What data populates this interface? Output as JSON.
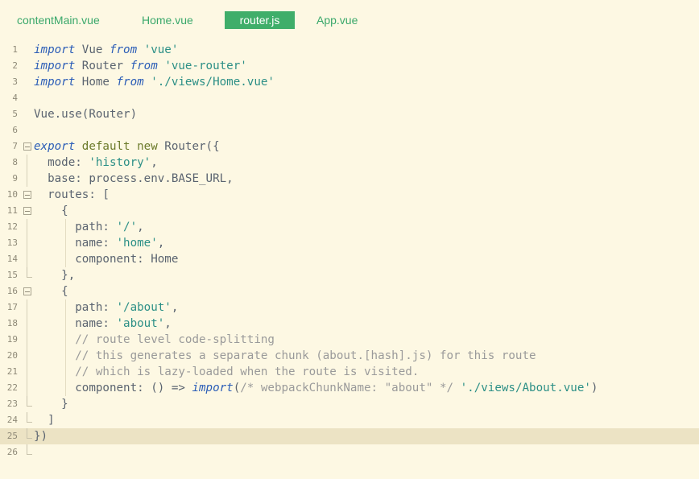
{
  "tabs": [
    {
      "label": "contentMain.vue",
      "active": false
    },
    {
      "label": "Home.vue",
      "active": false
    },
    {
      "label": "router.js",
      "active": true
    },
    {
      "label": "App.vue",
      "active": false
    }
  ],
  "current_line": 25,
  "lines": [
    {
      "n": "1",
      "fold": "",
      "guides": [],
      "tokens": [
        [
          "kw",
          "import"
        ],
        [
          "pl",
          " Vue "
        ],
        [
          "kw",
          "from"
        ],
        [
          "pl",
          " "
        ],
        [
          "str",
          "'vue'"
        ]
      ]
    },
    {
      "n": "2",
      "fold": "",
      "guides": [],
      "tokens": [
        [
          "kw",
          "import"
        ],
        [
          "pl",
          " Router "
        ],
        [
          "kw",
          "from"
        ],
        [
          "pl",
          " "
        ],
        [
          "str",
          "'vue-router'"
        ]
      ]
    },
    {
      "n": "3",
      "fold": "",
      "guides": [],
      "tokens": [
        [
          "kw",
          "import"
        ],
        [
          "pl",
          " Home "
        ],
        [
          "kw",
          "from"
        ],
        [
          "pl",
          " "
        ],
        [
          "str",
          "'./views/Home.vue'"
        ]
      ]
    },
    {
      "n": "4",
      "fold": "",
      "guides": [],
      "tokens": []
    },
    {
      "n": "5",
      "fold": "",
      "guides": [],
      "tokens": [
        [
          "pl",
          "Vue.use(Router)"
        ]
      ]
    },
    {
      "n": "6",
      "fold": "",
      "guides": [],
      "tokens": []
    },
    {
      "n": "7",
      "fold": "open",
      "guides": [],
      "tokens": [
        [
          "kw",
          "export"
        ],
        [
          "pl",
          " "
        ],
        [
          "kw2",
          "default"
        ],
        [
          "pl",
          " "
        ],
        [
          "kw2",
          "new"
        ],
        [
          "pl",
          " Router({"
        ]
      ]
    },
    {
      "n": "8",
      "fold": "line",
      "guides": [],
      "tokens": [
        [
          "pl",
          "  mode: "
        ],
        [
          "str",
          "'history'"
        ],
        [
          "pl",
          ","
        ]
      ]
    },
    {
      "n": "9",
      "fold": "line",
      "guides": [],
      "tokens": [
        [
          "pl",
          "  base: process.env.BASE_URL,"
        ]
      ]
    },
    {
      "n": "10",
      "fold": "open",
      "guides": [],
      "tokens": [
        [
          "pl",
          "  routes: ["
        ]
      ]
    },
    {
      "n": "11",
      "fold": "open",
      "guides": [],
      "tokens": [
        [
          "pl",
          "    {"
        ]
      ]
    },
    {
      "n": "12",
      "fold": "line",
      "guides": [
        81
      ],
      "tokens": [
        [
          "pl",
          "      path: "
        ],
        [
          "str",
          "'/'"
        ],
        [
          "pl",
          ","
        ]
      ]
    },
    {
      "n": "13",
      "fold": "line",
      "guides": [
        81
      ],
      "tokens": [
        [
          "pl",
          "      name: "
        ],
        [
          "str",
          "'home'"
        ],
        [
          "pl",
          ","
        ]
      ]
    },
    {
      "n": "14",
      "fold": "line",
      "guides": [
        81
      ],
      "tokens": [
        [
          "pl",
          "      component: Home"
        ]
      ]
    },
    {
      "n": "15",
      "fold": "end",
      "guides": [],
      "tokens": [
        [
          "pl",
          "    },"
        ]
      ]
    },
    {
      "n": "16",
      "fold": "open",
      "guides": [],
      "tokens": [
        [
          "pl",
          "    {"
        ]
      ]
    },
    {
      "n": "17",
      "fold": "line",
      "guides": [
        81
      ],
      "tokens": [
        [
          "pl",
          "      path: "
        ],
        [
          "str",
          "'/about'"
        ],
        [
          "pl",
          ","
        ]
      ]
    },
    {
      "n": "18",
      "fold": "line",
      "guides": [
        81
      ],
      "tokens": [
        [
          "pl",
          "      name: "
        ],
        [
          "str",
          "'about'"
        ],
        [
          "pl",
          ","
        ]
      ]
    },
    {
      "n": "19",
      "fold": "line",
      "guides": [
        81
      ],
      "tokens": [
        [
          "cm",
          "      // route level code-splitting"
        ]
      ]
    },
    {
      "n": "20",
      "fold": "line",
      "guides": [
        81
      ],
      "tokens": [
        [
          "cm",
          "      // this generates a separate chunk (about.[hash].js) for this route"
        ]
      ]
    },
    {
      "n": "21",
      "fold": "line",
      "guides": [
        81
      ],
      "tokens": [
        [
          "cm",
          "      // which is lazy-loaded when the route is visited."
        ]
      ]
    },
    {
      "n": "22",
      "fold": "line",
      "guides": [
        81
      ],
      "tokens": [
        [
          "pl",
          "      component: () => "
        ],
        [
          "fn",
          "import"
        ],
        [
          "pl",
          "("
        ],
        [
          "cm",
          "/* webpackChunkName: \"about\" */"
        ],
        [
          "pl",
          " "
        ],
        [
          "str",
          "'./views/About.vue'"
        ],
        [
          "pl",
          ")"
        ]
      ]
    },
    {
      "n": "23",
      "fold": "end",
      "guides": [],
      "tokens": [
        [
          "pl",
          "    }"
        ]
      ]
    },
    {
      "n": "24",
      "fold": "end",
      "guides": [],
      "tokens": [
        [
          "pl",
          "  ]"
        ]
      ]
    },
    {
      "n": "25",
      "fold": "end",
      "guides": [],
      "tokens": [
        [
          "pl",
          "})"
        ]
      ]
    },
    {
      "n": "26",
      "fold": "end",
      "guides": [],
      "tokens": []
    }
  ]
}
